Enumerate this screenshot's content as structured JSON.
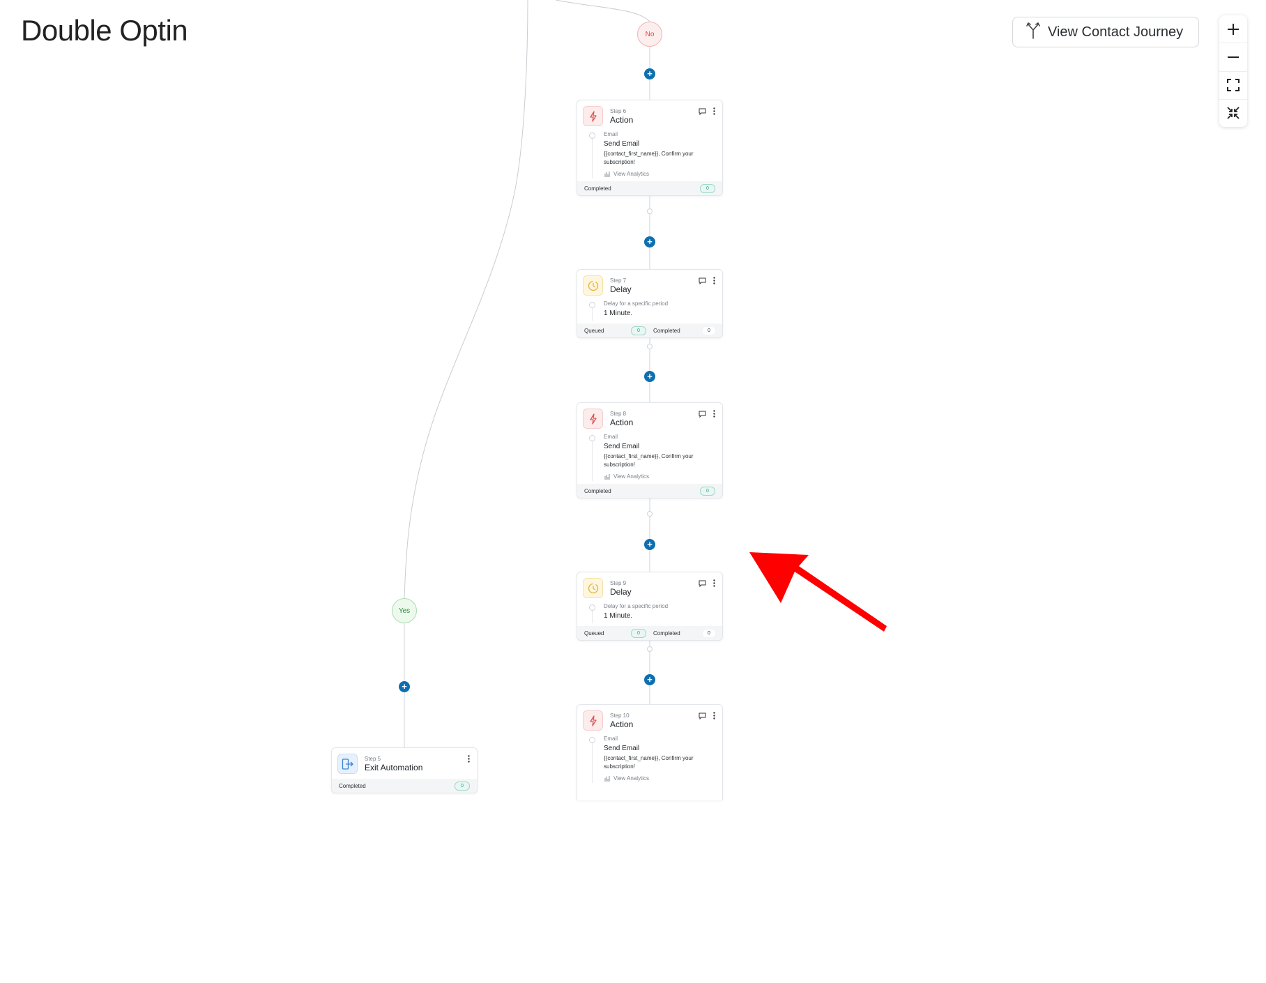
{
  "page": {
    "title": "Double Optin"
  },
  "toolbar": {
    "journey_label": "View Contact Journey"
  },
  "zoom": {
    "in_icon": "plus-icon",
    "out_icon": "minus-icon",
    "fit_icon": "fullscreen-icon",
    "shrink_icon": "collapse-icon"
  },
  "conditions": {
    "no": "No",
    "yes": "Yes"
  },
  "colors": {
    "plus_button": "#0e6fb0",
    "action_icon": "#e05252",
    "delay_icon": "#e6b23a",
    "exit_icon": "#3b82d6",
    "annotation_arrow": "#ff0000"
  },
  "steps": {
    "step5": {
      "num": "Step 5",
      "type": "Exit Automation",
      "foot_label": "Completed",
      "foot_count": "0"
    },
    "step6": {
      "num": "Step 6",
      "type": "Action",
      "sub": "Email",
      "main": "Send Email",
      "desc": "{{contact_first_name}}, Confirm your subscription!",
      "analytics": "View Analytics",
      "foot_label": "Completed",
      "foot_count": "0"
    },
    "step7": {
      "num": "Step 7",
      "type": "Delay",
      "sub": "Delay for a specific period",
      "main": "1 Minute.",
      "queued_label": "Queued",
      "queued_count": "0",
      "completed_label": "Completed",
      "completed_count": "0"
    },
    "step8": {
      "num": "Step 8",
      "type": "Action",
      "sub": "Email",
      "main": "Send Email",
      "desc": "{{contact_first_name}}, Confirm your subscription!",
      "analytics": "View Analytics",
      "foot_label": "Completed",
      "foot_count": "0"
    },
    "step9": {
      "num": "Step 9",
      "type": "Delay",
      "sub": "Delay for a specific period",
      "main": "1 Minute.",
      "queued_label": "Queued",
      "queued_count": "0",
      "completed_label": "Completed",
      "completed_count": "0"
    },
    "step10": {
      "num": "Step 10",
      "type": "Action",
      "sub": "Email",
      "main": "Send Email",
      "desc": "{{contact_first_name}}, Confirm your subscription!",
      "analytics": "View Analytics"
    }
  }
}
